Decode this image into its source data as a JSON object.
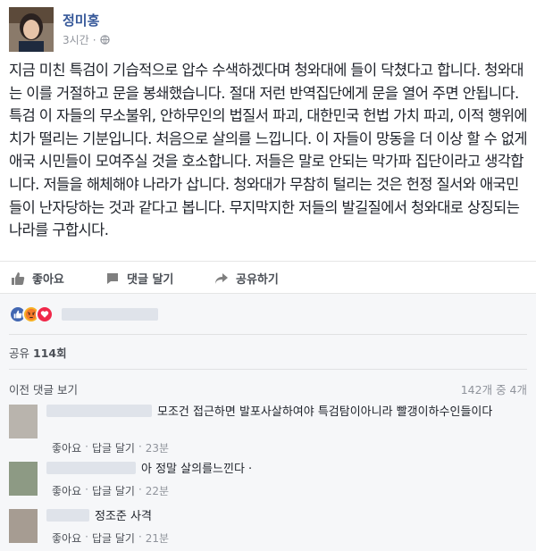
{
  "post": {
    "author": "정미홍",
    "time": "3시간",
    "privacy_icon": "globe-icon",
    "text_paragraphs": [
      "지금 미친 특검이 기습적으로 압수 수색하겠다며 청와대에 들이 닥쳤다고 합니다. 청와대는 이를 거절하고 문을 봉쇄했습니다. 절대 저런 반역집단에게 문을 열어 주면 안됩니다.",
      "특검 이 자들의 무소불위, 안하무인의 법질서 파괴, 대한민국 헌법 가치 파괴, 이적 행위에 치가 떨리는 기분입니다. 처음으로 살의를 느낍니다. 이 자들이 망동을 더 이상 할 수 없게 애국 시민들이 모여주실 것을 호소합니다. 저들은 말로 안되는 막가파 집단이라고 생각합니다. 저들을 해체해야 나라가 삽니다. 청와대가 무참히 털리는 것은 헌정 질서와 애국민들이 난자당하는 것과 같다고 봅니다. 무지막지한 저들의 발길질에서 청와대로 상징되는 나라를 구합시다."
    ]
  },
  "actions": {
    "like": "좋아요",
    "comment": "댓글 달기",
    "share": "공유하기"
  },
  "feedback": {
    "share_label": "공유",
    "share_count": "114회",
    "prev_comments": "이전 댓글 보기",
    "comment_count": "142개 중 4개"
  },
  "comments": [
    {
      "text": "모조건 접근하면 발포사살하여야 특검탐이아니라 빨갱이하수인들이다",
      "like": "좋아요",
      "reply": "답글 달기",
      "time": "23분"
    },
    {
      "text": "아 정말 살의를느낀다 ·",
      "like": "좋아요",
      "reply": "답글 달기",
      "time": "22분"
    },
    {
      "text": "정조준 사격",
      "like": "좋아요",
      "reply": "답글 달기",
      "time": "21분"
    }
  ],
  "colors": {
    "link_blue": "#365899",
    "like_blue": "#4267b2",
    "angry_orange": "#f7b125",
    "love_red": "#f0284a"
  }
}
